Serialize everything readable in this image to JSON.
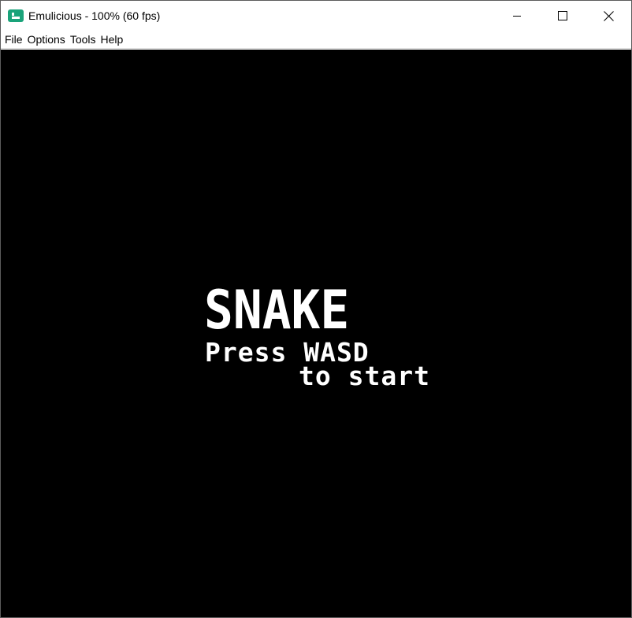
{
  "window": {
    "title": "Emulicious - 100% (60 fps)",
    "app_icon": "emulicious-icon",
    "controls": [
      "minimize-icon",
      "maximize-icon",
      "close-icon"
    ]
  },
  "menubar": {
    "items": [
      "File",
      "Options",
      "Tools",
      "Help"
    ]
  },
  "game": {
    "title": "SNAKE",
    "line1": "Press WASD",
    "line2": "to start"
  },
  "colors": {
    "screen_background": "#000000",
    "game_text": "#ffffff",
    "icon_accent": "#1aa37a"
  }
}
